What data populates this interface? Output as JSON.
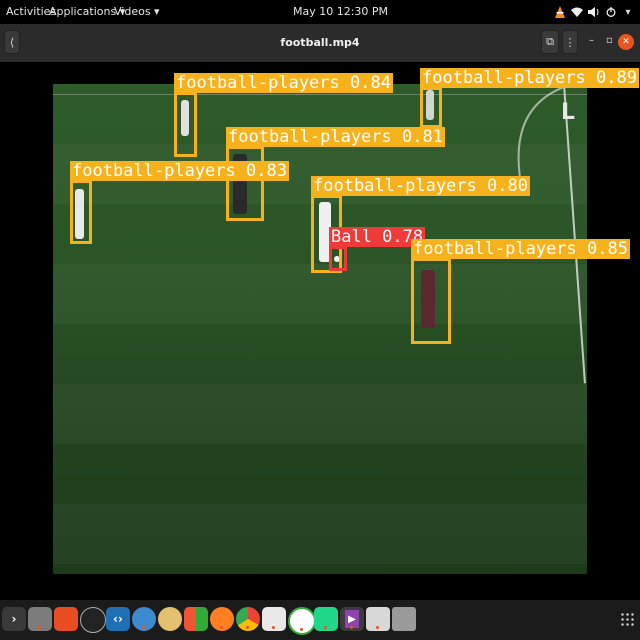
{
  "topbar": {
    "activities": "Activities",
    "applications": "Applications ▾",
    "videos": "Videos ▾",
    "clock": "May 10  12:30 PM",
    "tray_icons": [
      "vlc-icon",
      "wifi-icon",
      "volume-icon",
      "power-icon",
      "chevron-down-icon"
    ]
  },
  "window": {
    "title": "football.mp4",
    "back_icon": "⟨",
    "cast_icon": "⧉",
    "menu_icon": "⋮",
    "minimize_icon": "–",
    "maximize_icon": "▫",
    "close_icon": "✕"
  },
  "detections": [
    {
      "label": "football-players 0.84",
      "class": "football-players",
      "confidence": 0.84
    },
    {
      "label": "football-players 0.89",
      "class": "football-players",
      "confidence": 0.89
    },
    {
      "label": "football-players 0.81",
      "class": "football-players",
      "confidence": 0.81
    },
    {
      "label": "football-players 0.83",
      "class": "football-players",
      "confidence": 0.83
    },
    {
      "label": "football-players 0.80",
      "class": "football-players",
      "confidence": 0.8
    },
    {
      "label": "Ball 0.78",
      "class": "Ball",
      "confidence": 0.78
    },
    {
      "label": "football-players 0.85",
      "class": "football-players",
      "confidence": 0.85
    }
  ],
  "colors": {
    "player_box": "#f5b21c",
    "ball_box": "#ef3a3a",
    "accent": "#e95420"
  },
  "dock": {
    "apps": [
      {
        "name": "terminal-icon"
      },
      {
        "name": "files-icon"
      },
      {
        "name": "brave-icon"
      },
      {
        "name": "obs-icon"
      },
      {
        "name": "vscode-icon"
      },
      {
        "name": "android-studio-icon"
      },
      {
        "name": "rhythmbox-icon"
      },
      {
        "name": "app-grid-icon"
      },
      {
        "name": "firefox-icon"
      },
      {
        "name": "chrome-icon"
      },
      {
        "name": "document-viewer-icon"
      },
      {
        "name": "anaconda-icon"
      },
      {
        "name": "pycharm-icon"
      },
      {
        "name": "videos-icon"
      },
      {
        "name": "image-viewer-icon"
      },
      {
        "name": "trash-icon"
      }
    ],
    "show_apps_icon": "show-applications-icon"
  }
}
